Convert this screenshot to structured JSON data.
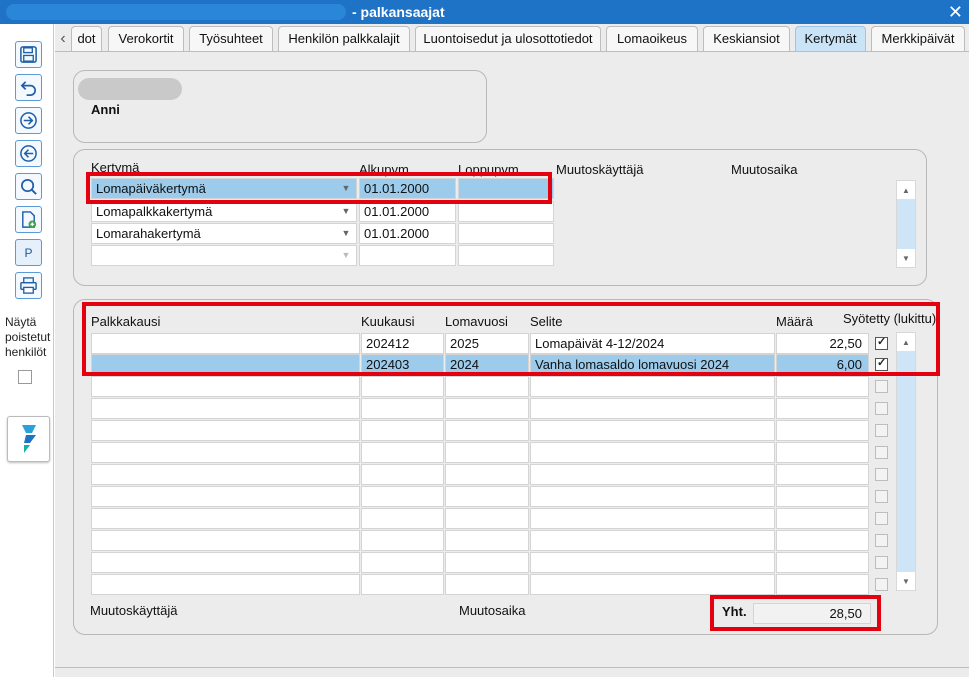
{
  "window": {
    "title": "- palkansaajat",
    "close_glyph": "✕"
  },
  "toolbar": {
    "buttons": [
      {
        "name": "save-icon"
      },
      {
        "name": "undo-icon"
      },
      {
        "name": "forward-icon"
      },
      {
        "name": "back-icon"
      },
      {
        "name": "search-icon"
      },
      {
        "name": "new-document-icon"
      },
      {
        "name": "p-button",
        "label": "P"
      },
      {
        "name": "print-icon"
      }
    ],
    "show_deleted_label": "Näytä poistetut henkilöt",
    "show_deleted_checked": false,
    "logo_icon": "app-logo-icon"
  },
  "tabs": {
    "items": [
      {
        "label": "dot"
      },
      {
        "label": "Verokortit"
      },
      {
        "label": "Työsuhteet"
      },
      {
        "label": "Henkilön palkkalajit"
      },
      {
        "label": "Luontoisedut ja ulosottotiedot"
      },
      {
        "label": "Lomaoikeus"
      },
      {
        "label": "Keskiansiot"
      },
      {
        "label": "Kertymät"
      },
      {
        "label": "Merkkipäivät"
      }
    ],
    "active": "Kertymät"
  },
  "person": {
    "first_name": "Anni"
  },
  "accruals": {
    "headers": {
      "type": "Kertymä",
      "start": "Alkupvm.",
      "end": "Loppupvm.",
      "modifier": "Muutoskäyttäjä",
      "modified": "Muutosaika"
    },
    "rows": [
      {
        "type": "Lomapäiväkertymä",
        "start": "01.01.2000",
        "end": "",
        "selected": true
      },
      {
        "type": "Lomapalkkakertymä",
        "start": "01.01.2000",
        "end": "",
        "selected": false
      },
      {
        "type": "Lomarahakertymä",
        "start": "01.01.2000",
        "end": "",
        "selected": false
      },
      {
        "type": "",
        "start": "",
        "end": "",
        "selected": false
      }
    ]
  },
  "entries": {
    "headers": {
      "period": "Palkkakausi",
      "month": "Kuukausi",
      "holiday_year": "Lomavuosi",
      "description": "Selite",
      "amount": "Määrä",
      "entered": "Syötetty (lukittu)"
    },
    "rows": [
      {
        "period": "",
        "month": "202412",
        "holiday_year": "2025",
        "description": "Lomapäivät 4-12/2024",
        "amount": "22,50",
        "entered": true,
        "selected": false
      },
      {
        "period": "",
        "month": "202403",
        "holiday_year": "2024",
        "description": "Vanha lomasaldo lomavuosi 2024",
        "amount": "6,00",
        "entered": true,
        "selected": true
      }
    ],
    "empty_rows": 10,
    "footer": {
      "modifier_label": "Muutoskäyttäjä",
      "modified_label": "Muutosaika",
      "total_label": "Yht.",
      "total_value": "28,50"
    }
  },
  "colors": {
    "titlebar": "#1e73c6",
    "selection": "#9ccbeb",
    "active_tab": "#c9e3f7",
    "highlight": "#e3000f"
  }
}
